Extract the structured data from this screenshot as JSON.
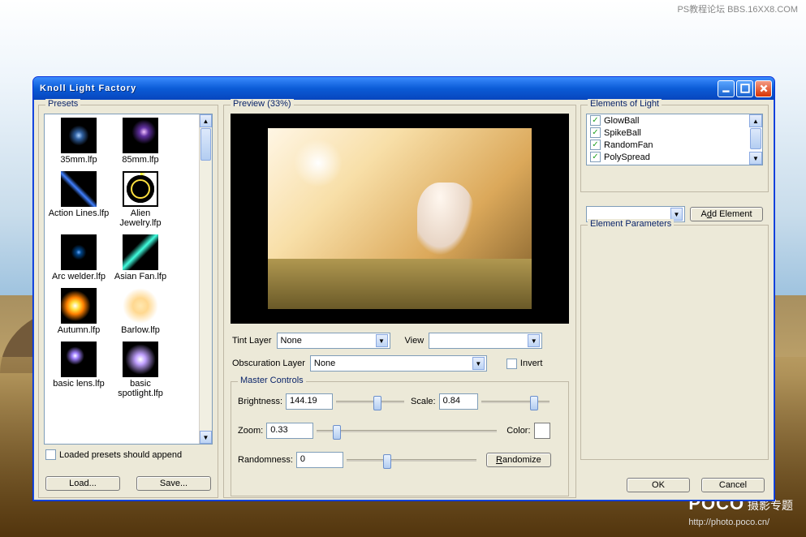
{
  "watermark_top": "PS教程论坛\nBBS.16XX8.COM",
  "watermark_bottom_brand": "POCO",
  "watermark_bottom_text": " 摄影专题",
  "watermark_bottom_url": "http://photo.poco.cn/",
  "window": {
    "title": "Knoll Light Factory"
  },
  "presets": {
    "legend": "Presets",
    "items": [
      {
        "label": "35mm.lfp",
        "cls": "th-35mm"
      },
      {
        "label": "85mm.lfp",
        "cls": "th-85mm"
      },
      {
        "label": "Action Lines.lfp",
        "cls": "th-action"
      },
      {
        "label": "Alien Jewelry.lfp",
        "cls": "th-alien"
      },
      {
        "label": "Arc welder.lfp",
        "cls": "th-arc"
      },
      {
        "label": "Asian Fan.lfp",
        "cls": "th-asian"
      },
      {
        "label": "Autumn.lfp",
        "cls": "th-autumn"
      },
      {
        "label": "Barlow.lfp",
        "cls": "th-barlow"
      },
      {
        "label": "basic lens.lfp",
        "cls": "th-basiclens"
      },
      {
        "label": "basic spotlight.lfp",
        "cls": "th-basicspot"
      }
    ],
    "append_label": "Loaded presets should append",
    "append_checked": false,
    "load_btn": "Load...",
    "save_btn": "Save..."
  },
  "preview": {
    "legend": "Preview (33%)",
    "tint_label": "Tint Layer",
    "tint_value": "None",
    "view_label": "View",
    "view_value": "",
    "obsc_label": "Obscuration Layer",
    "obsc_value": "None",
    "invert_label": "Invert",
    "invert_checked": false,
    "master": {
      "legend": "Master Controls",
      "brightness_label": "Brightness:",
      "brightness_value": "144.19",
      "scale_label": "Scale:",
      "scale_value": "0.84",
      "zoom_label": "Zoom:",
      "zoom_value": "0.33",
      "color_label": "Color:",
      "color_value": "#ffffff",
      "randomness_label": "Randomness:",
      "randomness_value": "0",
      "randomize_btn": "Randomize"
    }
  },
  "elements": {
    "legend": "Elements of Light",
    "items": [
      {
        "label": "GlowBall",
        "checked": true
      },
      {
        "label": "SpikeBall",
        "checked": true
      },
      {
        "label": "RandomFan",
        "checked": true
      },
      {
        "label": "PolySpread",
        "checked": true
      }
    ],
    "add_dropdown": "",
    "addbtn_prefix": "A",
    "addbtn_text_underline": "d",
    "addbtn_suffix": "d Element"
  },
  "params": {
    "legend": "Element Parameters"
  },
  "footer": {
    "ok": "OK",
    "cancel": "Cancel"
  }
}
